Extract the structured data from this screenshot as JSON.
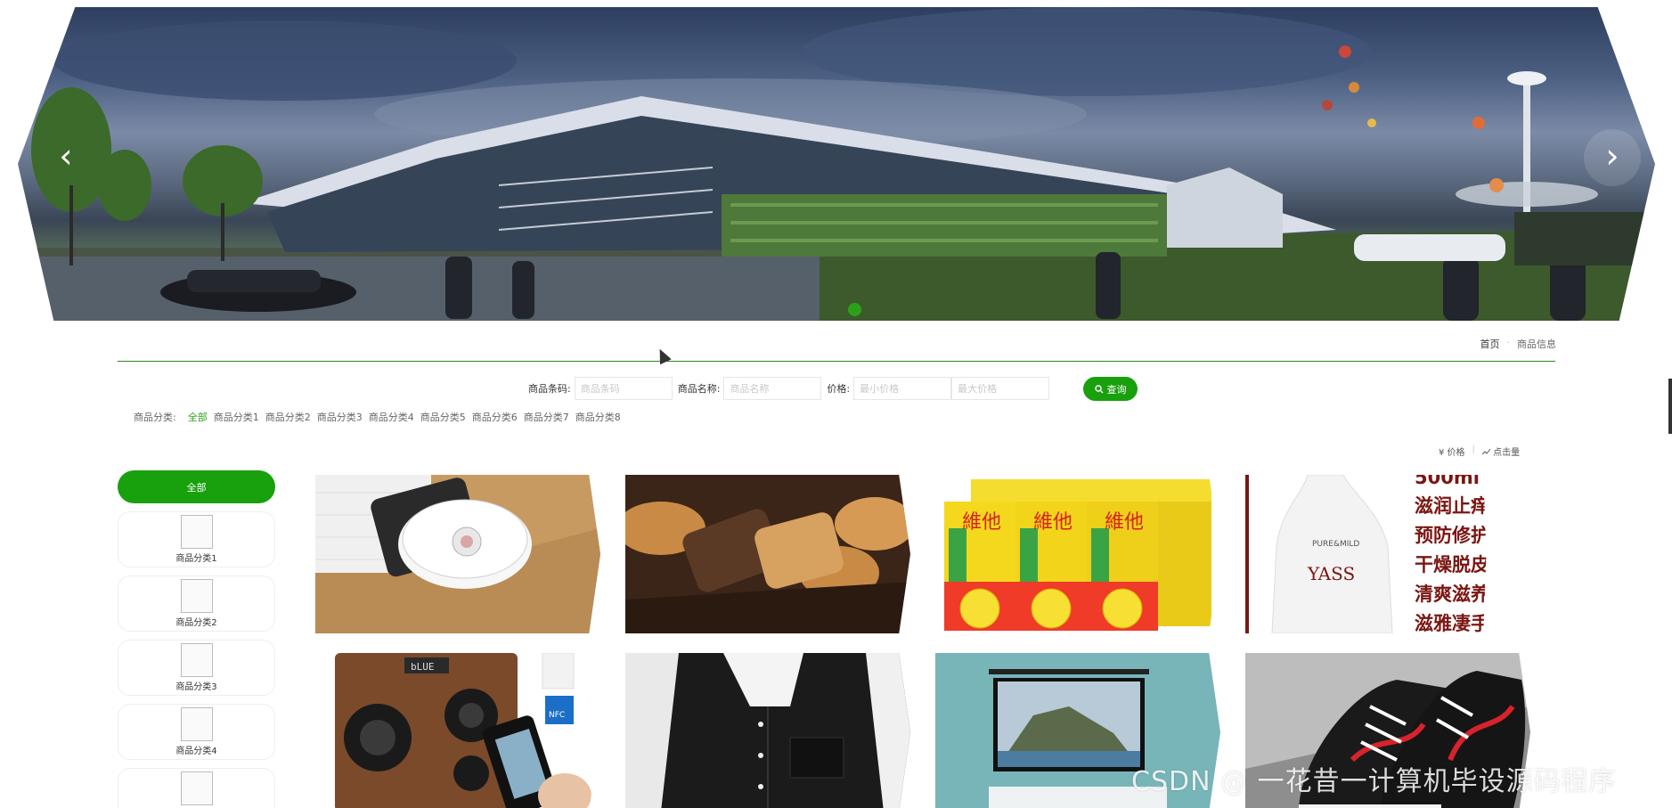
{
  "banner": {
    "prev_label": "‹",
    "next_label": "›"
  },
  "breadcrumb": {
    "home": "首页",
    "separator": "·",
    "current": "商品信息"
  },
  "search": {
    "code_label": "商品条码:",
    "code_placeholder": "商品条码",
    "name_label": "商品名称:",
    "name_placeholder": "商品名称",
    "price_label": "价格:",
    "min_price_placeholder": "最小价格",
    "max_price_placeholder": "最大价格",
    "button_label": "查询"
  },
  "category_filter": {
    "title": "商品分类:",
    "items": [
      "全部",
      "商品分类1",
      "商品分类2",
      "商品分类3",
      "商品分类4",
      "商品分类5",
      "商品分类6",
      "商品分类7",
      "商品分类8"
    ]
  },
  "sort": {
    "price": "¥ 价格",
    "clicks": "点击量"
  },
  "sidebar": {
    "all_label": "全部",
    "items": [
      {
        "label": "商品分类1"
      },
      {
        "label": "商品分类2"
      },
      {
        "label": "商品分类3"
      },
      {
        "label": "商品分类4"
      },
      {
        "label": ""
      }
    ]
  },
  "products": {
    "lotion_text": [
      "500ml",
      "滋润止痒",
      "预防修护",
      "干燥脱皮",
      "清爽滋养",
      "滋雅凄手\""
    ],
    "lotion_brand": "YASS",
    "lotion_badge": "PURE&MILD",
    "drink_brand": "維他",
    "speaker_screen": "bLUE",
    "nfc_label": "NFC"
  },
  "watermark": "CSDN @ 一花昔一计算机毕设源码程序",
  "colors": {
    "accent": "#19a00d",
    "divider": "#2b8a18"
  }
}
